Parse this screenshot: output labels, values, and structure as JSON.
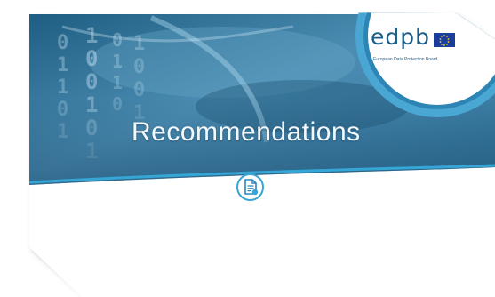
{
  "cover": {
    "title": "Recommendations",
    "logo_text": "edpb",
    "logo_subtitle": "European Data Protection Board"
  },
  "colors": {
    "banner": "#3f86ad",
    "accent": "#35a6d6",
    "logo": "#1c5e86"
  },
  "icons": {
    "flag": "eu-flag-icon",
    "document": "document-icon"
  }
}
